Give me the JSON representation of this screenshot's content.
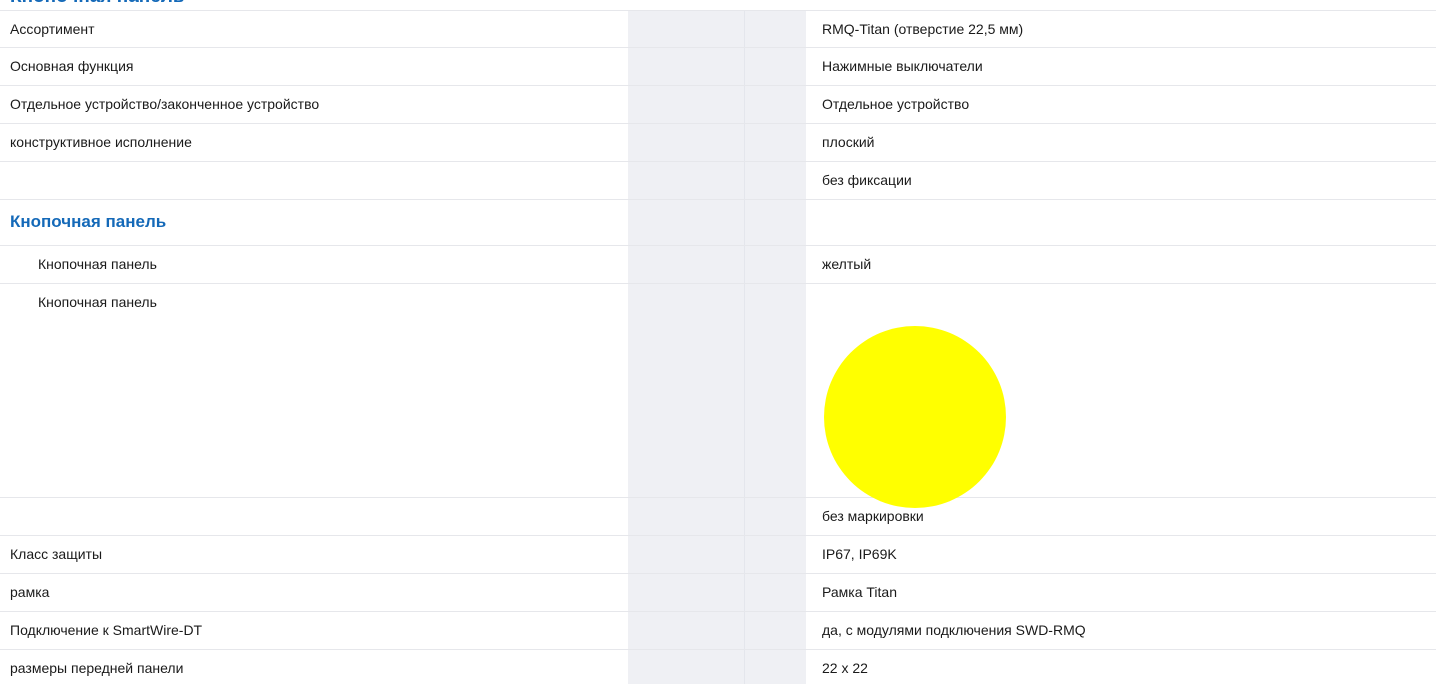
{
  "heading_top": "Кнопочная панель",
  "accent_color": "#1469b8",
  "rows": [
    {
      "label": "Ассортимент",
      "value": "RMQ-Titan (отверстие 22,5 мм)"
    },
    {
      "label": "Основная функция",
      "value": "Нажимные выключатели"
    },
    {
      "label": "Отдельное устройство/законченное устройство",
      "value": "Отдельное устройство"
    },
    {
      "label": "конструктивное исполнение",
      "value": "плоский"
    },
    {
      "label": "",
      "value": "без фиксации"
    }
  ],
  "section": {
    "title": "Кнопочная панель",
    "rows": [
      {
        "label": "Кнопочная панель",
        "value": "желтый"
      },
      {
        "label": "Кнопочная панель",
        "swatch_color": "#ffff00",
        "swatch_icon": "yellow-circle-swatch"
      }
    ]
  },
  "rows_after": [
    {
      "label": "",
      "value": "без маркировки"
    },
    {
      "label": "Класс защиты",
      "value": "IP67, IP69K"
    },
    {
      "label": "рамка",
      "value": "Рамка Titan"
    },
    {
      "label": "Подключение к SmartWire-DT",
      "value": "да, с модулями подключения SWD-RMQ"
    },
    {
      "label": "размеры передней панели",
      "value": "22 x 22"
    }
  ]
}
